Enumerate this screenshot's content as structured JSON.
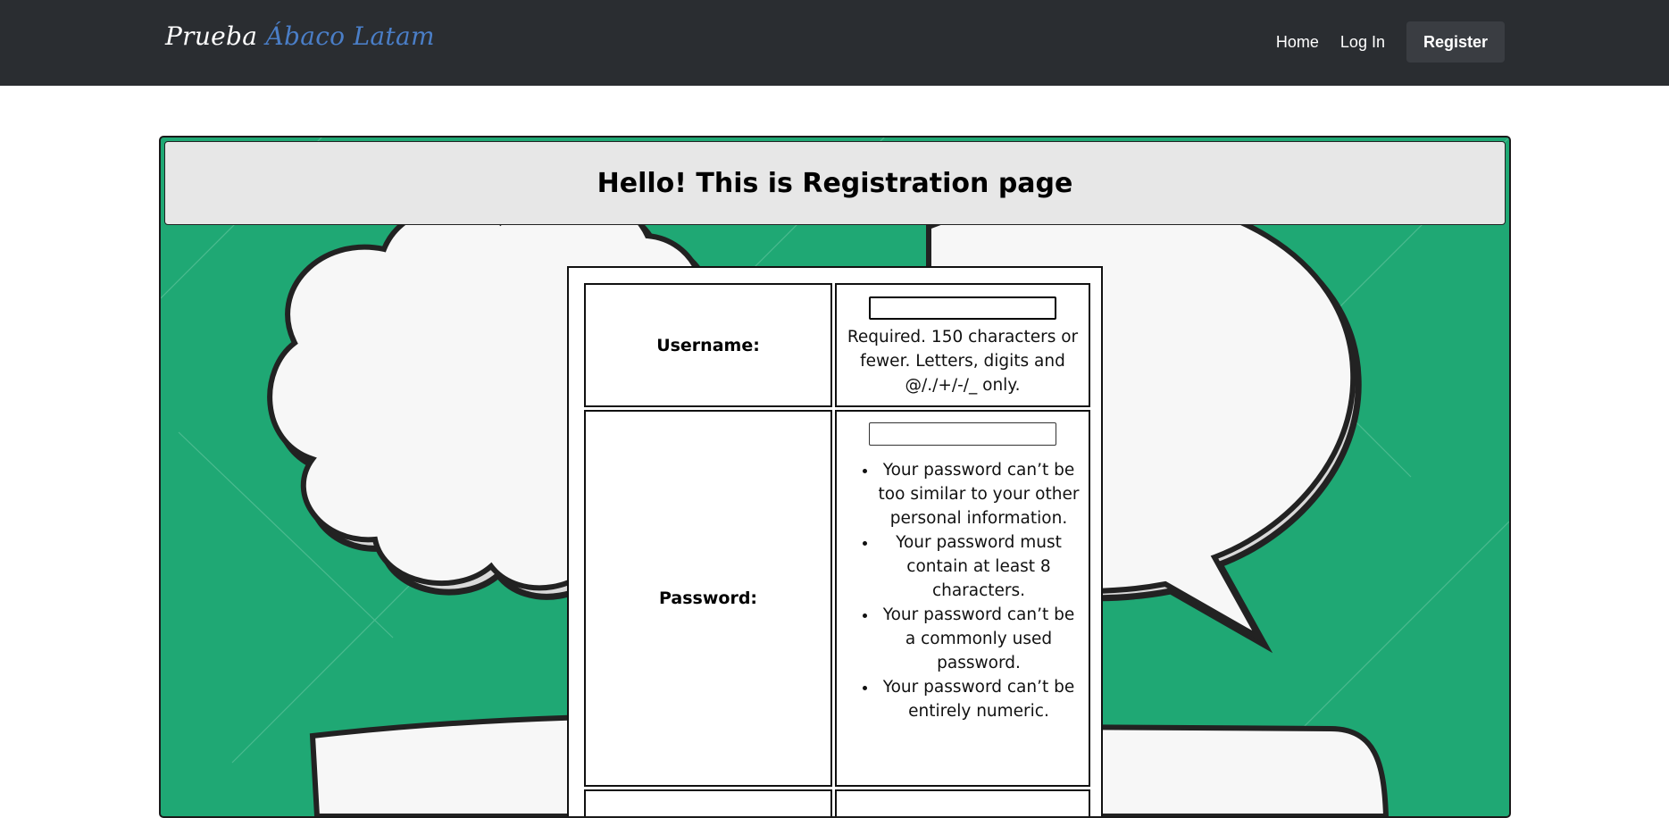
{
  "navbar": {
    "brand_main": "Prueba",
    "brand_accent": "Ábaco Latam",
    "links": {
      "home": "Home",
      "login": "Log In",
      "register": "Register"
    }
  },
  "page": {
    "title": "Hello! This is Registration page",
    "background_color": "#1fa874"
  },
  "form": {
    "username": {
      "label": "Username:",
      "value": "",
      "help": "Required. 150 characters or fewer. Letters, digits and @/./+/-/_ only."
    },
    "password": {
      "label": "Password:",
      "value": "",
      "rules": [
        "Your password can’t be too similar to your other personal information.",
        "Your password must contain at least 8 characters.",
        "Your password can’t be a commonly used password.",
        "Your password can’t be entirely numeric."
      ]
    }
  }
}
